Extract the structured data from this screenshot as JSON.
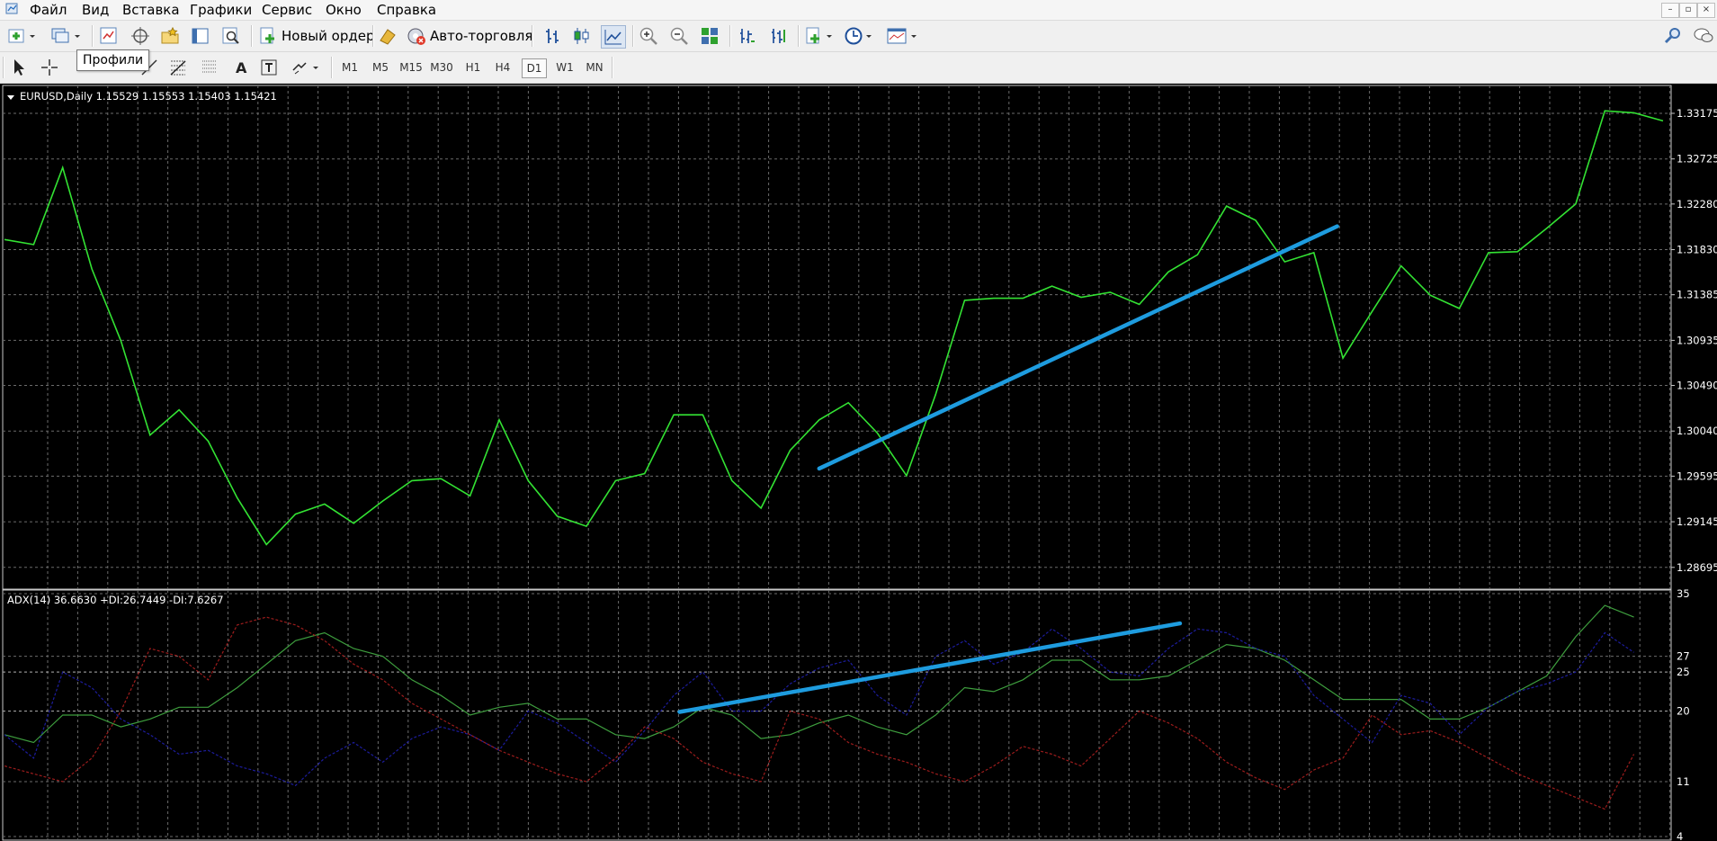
{
  "menu": {
    "items": [
      "Файл",
      "Вид",
      "Вставка",
      "Графики",
      "Сервис",
      "Окно",
      "Справка"
    ]
  },
  "window_controls": {
    "minimize": "–",
    "restore": "▫",
    "close": "×"
  },
  "toolbar": {
    "new_order_label": "Новый ордер",
    "autotrading_label": "Авто-торговля",
    "profiles_tooltip": "Профили"
  },
  "timeframes": {
    "items": [
      "M1",
      "M5",
      "M15",
      "M30",
      "H1",
      "H4",
      "D1",
      "W1",
      "MN"
    ],
    "active": "D1"
  },
  "main_chart": {
    "header": "EURUSD,Daily  1.15529 1.15553 1.15403 1.15421",
    "price_labels": [
      "1.33175",
      "1.32725",
      "1.32280",
      "1.31830",
      "1.31385",
      "1.30935",
      "1.30490",
      "1.30040",
      "1.29595",
      "1.29145",
      "1.28695"
    ]
  },
  "adx_panel": {
    "header": "ADX(14) 36.6630 +DI:26.7449 -DI:7.6267",
    "scale_labels": [
      "35",
      "27",
      "25",
      "20",
      "11",
      "4"
    ]
  },
  "chart_data": [
    {
      "type": "line",
      "symbol": "EURUSD",
      "timeframe": "Daily",
      "ylim": [
        1.2848,
        1.3345
      ],
      "grid": true,
      "series": [
        {
          "color": "#33e233",
          "values": [
            1.3193,
            1.3188,
            1.3264,
            1.3164,
            1.3093,
            1.3,
            1.3025,
            1.2994,
            1.2938,
            1.2892,
            1.2922,
            1.2932,
            1.2913,
            1.2935,
            1.2955,
            1.2957,
            1.294,
            1.3015,
            1.2955,
            1.292,
            1.291,
            1.2955,
            1.2962,
            1.302,
            1.302,
            1.2955,
            1.2928,
            1.2985,
            1.3015,
            1.3032,
            1.3002,
            1.296,
            1.304,
            1.3133,
            1.3135,
            1.3135,
            1.3147,
            1.3136,
            1.3141,
            1.3129,
            1.3161,
            1.3178,
            1.3226,
            1.3212,
            1.3171,
            1.318,
            1.3076,
            1.3122,
            1.3167,
            1.3138,
            1.3125,
            1.318,
            1.3181,
            1.3204,
            1.3228,
            1.332,
            1.3318,
            1.331
          ]
        }
      ],
      "trendline": {
        "color": "#1e9cdf",
        "from": [
          28,
          1.2967
        ],
        "to": [
          45.8,
          1.3206
        ]
      }
    },
    {
      "type": "line",
      "indicator": "ADX(14)",
      "ylim": [
        4,
        35
      ],
      "levels": [
        25,
        20
      ],
      "grid": true,
      "series": [
        {
          "color": "#3e9e3e",
          "values": [
            17,
            16,
            19.5,
            19.5,
            18,
            19,
            20.5,
            20.5,
            23,
            26,
            29,
            30,
            28,
            27,
            24,
            22,
            19.5,
            20.5,
            21,
            19,
            19,
            17,
            16.5,
            18,
            20.5,
            19.5,
            16.5,
            17,
            18.5,
            19.5,
            18,
            17,
            19.5,
            23,
            22.5,
            24,
            26.5,
            26.5,
            24,
            24,
            24.5,
            26.5,
            28.5,
            28,
            26.5,
            24,
            21.5,
            21.5,
            21.5,
            19,
            19,
            20.5,
            22.5,
            24.5,
            29.5,
            33.5,
            32
          ]
        },
        {
          "color": "#1c1c9c",
          "values": [
            17,
            14,
            25,
            23,
            19,
            17,
            14.5,
            15,
            13,
            12,
            10.5,
            14,
            16,
            13.5,
            16.5,
            18,
            17,
            15,
            20,
            18.5,
            16,
            13.5,
            17.5,
            22,
            25,
            20,
            20,
            23.5,
            25.5,
            26.5,
            22,
            19.5,
            27,
            29,
            26,
            27.5,
            30.5,
            28,
            25,
            24.5,
            28,
            30.5,
            30,
            28,
            27,
            22,
            19,
            16,
            22,
            21,
            17,
            20.5,
            22.5,
            23.5,
            25,
            30,
            27.5
          ]
        },
        {
          "color": "#9c1c1c",
          "values": [
            13,
            12,
            11,
            14,
            20,
            28,
            27,
            24,
            31,
            32,
            31,
            29,
            26,
            24,
            21,
            19,
            17,
            15,
            13.5,
            12,
            11,
            14,
            18,
            16.5,
            13.5,
            12,
            11,
            20,
            19,
            16,
            14.5,
            13.5,
            12,
            11,
            13,
            15.5,
            14.5,
            13,
            16.5,
            20,
            18.5,
            16.5,
            13.5,
            11.5,
            10,
            12.5,
            14,
            19.5,
            17,
            17.5,
            16,
            14,
            12,
            10.5,
            9,
            7.5,
            14.5
          ]
        }
      ],
      "trendline": {
        "color": "#1e9cdf",
        "from": [
          23.2,
          19.9
        ],
        "to": [
          40.4,
          31.2
        ]
      }
    }
  ]
}
